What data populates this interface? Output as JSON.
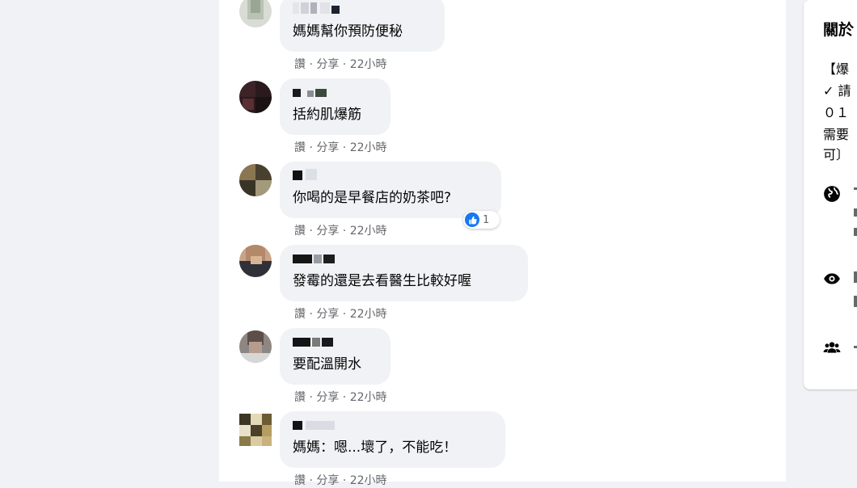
{
  "comments": [
    {
      "text": "媽媽幫你預防便秘",
      "actions": "讚 · 分享 · 22小時"
    },
    {
      "text": "括約肌爆筋",
      "actions": "讚 · 分享 · 22小時"
    },
    {
      "text": "你喝的是早餐店的奶茶吧?",
      "actions": "讚 · 分享 · 22小時",
      "reaction_count": "1"
    },
    {
      "text": "發霉的還是去看醫生比較好喔",
      "actions": "讚 · 分享 · 22小時"
    },
    {
      "text": "要配溫開水",
      "actions": "讚 · 分享 · 22小時"
    },
    {
      "text": "媽媽：嗯...壞了，不能吃！",
      "actions": "讚 · 分享 · 22小時"
    }
  ],
  "sidebar": {
    "title": "關於",
    "lines": [
      "【爆",
      "✓ 請",
      "０１",
      "需要",
      "可〕"
    ],
    "icons": [
      "globe-icon",
      "eye-icon",
      "people-icon"
    ]
  },
  "colors": {
    "page_bg": "#f0f2f5",
    "bubble_bg": "#f0f2f5",
    "meta_text": "#65676b",
    "like_blue": "#1877f2"
  }
}
